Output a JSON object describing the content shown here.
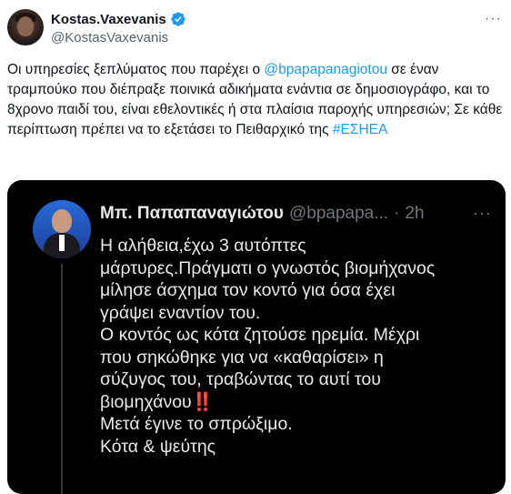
{
  "author": {
    "display_name": "Kostas.Vaxevanis",
    "handle": "@KostasVaxevanis"
  },
  "icons": {
    "avatar": "profile-photo",
    "verified": "verified-badge-icon",
    "more": "more-options-icon"
  },
  "tweet": {
    "part1": "Οι υπηρεσίες ξεπλύματος που παρέχει ο ",
    "mention": "@bpapapanagiotou",
    "part2": " σε έναν τραμπούκο που διέπραξε ποινικά αδικήματα ενάντια  σε δημοσιογράφο, και το 8χρονο παιδί του, είναι εθελοντικές ή στα πλαίσια παροχής υπηρεσιών; Σε κάθε περίπτωση πρέπει να το εξετάσει το Πειθαρχικό της ",
    "hashtag": "#ΕΣΗΕΑ"
  },
  "embedded": {
    "display_name": "Μπ. Παπαπαναγιώτου",
    "handle": "@bpapapa...",
    "separator": "·",
    "time": "2h",
    "more": "···",
    "lines": {
      "l1": "Η αλήθεια,έχω 3 αυτόπτες",
      "l2": "μάρτυρες.Πράγματι ο γνωστός βιομήχανος",
      "l3": "μίλησε άσχημα τον κοντό για όσα έχει",
      "l4": "γράψει εναντίον του.",
      "l5": "Ο κοντός ως κότα ζητούσε ηρεμία. Μέχρι",
      "l6": "που σηκώθηκε για να «καθαρίσει» η",
      "l7": "σύζυγος του, τραβώντας το αυτί του",
      "l8": "βιομηχάνου",
      "l8_emoji": "‼️",
      "l9": "Μετά έγινε το σπρώξιμο.",
      "l10": "Κότα & ψεύτης"
    }
  },
  "colors": {
    "link": "#1d9bf0",
    "verified": "#1d9bf0",
    "embed_bg": "#000000",
    "emoji": "#e0245e"
  }
}
